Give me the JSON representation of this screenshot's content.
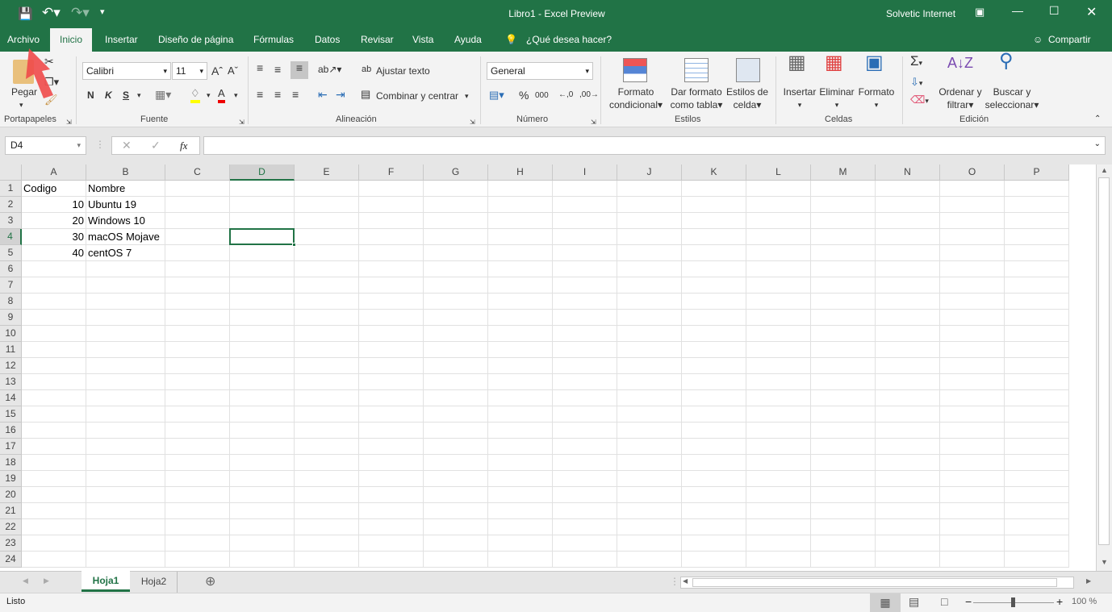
{
  "title_bar": {
    "title": "Libro1  -  Excel Preview",
    "user": "Solvetic Internet"
  },
  "qat": {
    "save_icon": "save-icon",
    "undo_icon": "undo-icon",
    "redo_icon": "redo-icon"
  },
  "tabs": [
    "Archivo",
    "Inicio",
    "Insertar",
    "Diseño de página",
    "Fórmulas",
    "Datos",
    "Revisar",
    "Vista",
    "Ayuda"
  ],
  "active_tab": "Inicio",
  "tell_me": "¿Qué desea hacer?",
  "share": "Compartir",
  "ribbon": {
    "clipboard": {
      "paste": "Pegar",
      "label": "Portapapeles"
    },
    "font": {
      "name": "Calibri",
      "size": "11",
      "bold": "N",
      "italic": "K",
      "underline": "S",
      "label": "Fuente",
      "fill_color": "#ffff00",
      "font_color": "#ff0000"
    },
    "alignment": {
      "wrap": "Ajustar texto",
      "merge": "Combinar y centrar",
      "label": "Alineación"
    },
    "number": {
      "format": "General",
      "percent": "%",
      "thousands": "000",
      "label": "Número"
    },
    "styles": {
      "conditional": [
        "Formato",
        "condicional"
      ],
      "table": [
        "Dar formato",
        "como tabla"
      ],
      "cell": [
        "Estilos de",
        "celda"
      ],
      "label": "Estilos"
    },
    "cells": {
      "insert": "Insertar",
      "delete": "Eliminar",
      "format": "Formato",
      "label": "Celdas"
    },
    "editing": {
      "sort": [
        "Ordenar y",
        "filtrar"
      ],
      "find": [
        "Buscar y",
        "seleccionar"
      ],
      "label": "Edición"
    }
  },
  "formula_bar": {
    "name_box": "D4",
    "fx": "fx",
    "value": ""
  },
  "grid": {
    "columns": [
      "A",
      "B",
      "C",
      "D",
      "E",
      "F",
      "G",
      "H",
      "I",
      "J",
      "K",
      "L",
      "M",
      "N",
      "O",
      "P"
    ],
    "rows": 24,
    "selected": "D4",
    "cells": [
      {
        "ref": "A1",
        "value": "Codigo",
        "type": "text"
      },
      {
        "ref": "B1",
        "value": "Nombre",
        "type": "text"
      },
      {
        "ref": "A2",
        "value": "10",
        "type": "num"
      },
      {
        "ref": "B2",
        "value": "Ubuntu 19",
        "type": "text"
      },
      {
        "ref": "A3",
        "value": "20",
        "type": "num"
      },
      {
        "ref": "B3",
        "value": "Windows 10",
        "type": "text"
      },
      {
        "ref": "A4",
        "value": "30",
        "type": "num"
      },
      {
        "ref": "B4",
        "value": "macOS Mojave",
        "type": "text"
      },
      {
        "ref": "A5",
        "value": "40",
        "type": "num"
      },
      {
        "ref": "B5",
        "value": "centOS 7",
        "type": "text"
      }
    ]
  },
  "sheets": [
    "Hoja1",
    "Hoja2"
  ],
  "active_sheet": "Hoja1",
  "status": {
    "text": "Listo",
    "zoom": "100 %",
    "zoom_level": 100
  }
}
